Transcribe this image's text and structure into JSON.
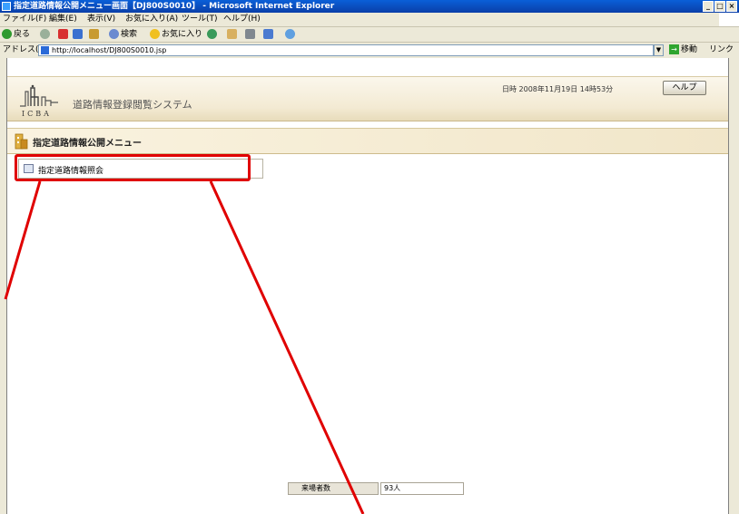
{
  "window": {
    "title": "指定道路情報公開メニュー画面【DJ800S0010】 - Microsoft Internet Explorer",
    "controls": [
      "_",
      "□",
      "×"
    ]
  },
  "menubar": {
    "items": [
      "ファイル(F)",
      "編集(E)",
      "表示(V)",
      "お気に入り(A)",
      "ツール(T)",
      "ヘルプ(H)"
    ]
  },
  "toolbar": {
    "back": "戻る",
    "search": "検索",
    "favorites": "お気に入り"
  },
  "addressbar": {
    "label": "アドレス(D)",
    "url": "http://localhost/DJ800S0010.jsp",
    "go": "移動",
    "links": "リンク"
  },
  "header": {
    "logo_text": "ICBA",
    "system_name": "道路情報登録閲覧システム",
    "datetime": "日時 2008年11月19日 14時53分",
    "help_button": "ヘルプ"
  },
  "menu": {
    "heading": "指定道路情報公開メニュー",
    "entries": [
      {
        "label": "指定道路情報照会"
      }
    ]
  },
  "footer": {
    "visitor_label": "来場者数",
    "visitor_count": "93人"
  },
  "colors": {
    "highlight": "#e00000",
    "titlebar": "#0a50c8",
    "header_band": "#f3ead3"
  }
}
